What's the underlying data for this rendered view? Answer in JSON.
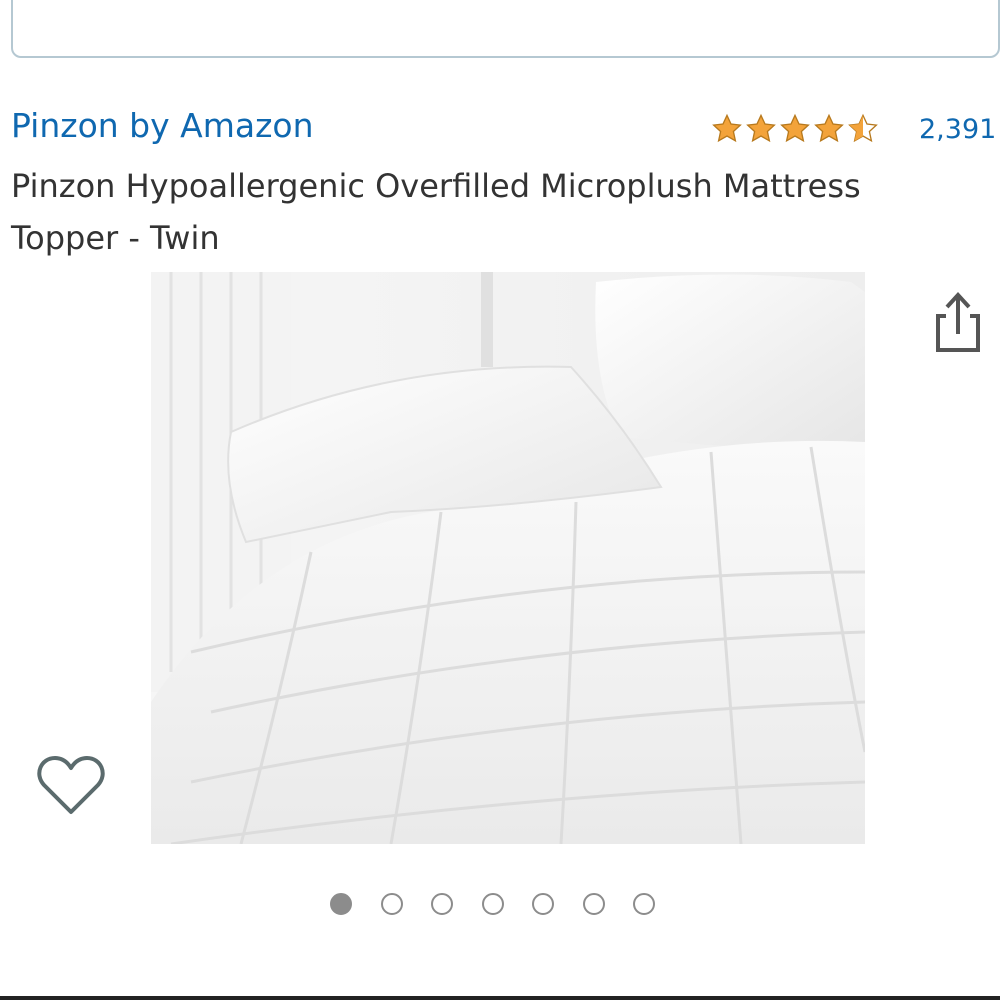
{
  "brand": {
    "name": "Pinzon by Amazon",
    "color": "#0f68b0"
  },
  "rating": {
    "stars": 4.5,
    "out_of": 5,
    "review_count": "2,391",
    "star_color": "#f3a33a"
  },
  "product": {
    "title": "Pinzon Hypoallergenic Overfilled Microplush Mattress Topper - Twin",
    "image_alt": "White quilted mattress topper with pillows"
  },
  "actions": {
    "share_icon": "share-icon",
    "wishlist_icon": "heart-icon"
  },
  "carousel": {
    "total_images": 7,
    "active_index": 0
  }
}
